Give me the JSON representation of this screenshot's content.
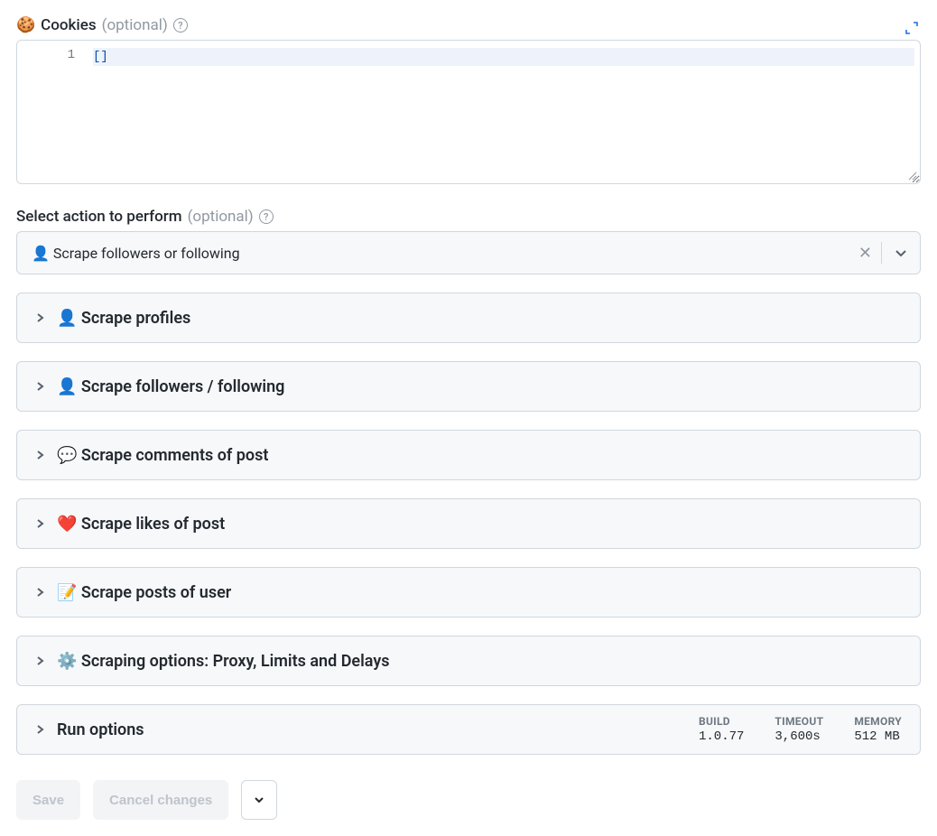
{
  "cookies": {
    "label_emoji": "🍪",
    "label_text": "Cookies",
    "optional": "(optional)",
    "line_number": "1",
    "content": "[]"
  },
  "action_select": {
    "label": "Select action to perform",
    "optional": "(optional)",
    "value": "👤 Scrape followers or following"
  },
  "accordions": [
    {
      "label": "👤 Scrape profiles"
    },
    {
      "label": "👤 Scrape followers / following"
    },
    {
      "label": "💬 Scrape comments of post"
    },
    {
      "label": "❤️ Scrape likes of post"
    },
    {
      "label": "📝 Scrape posts of user"
    },
    {
      "label": "⚙️ Scraping options: Proxy, Limits and Delays"
    }
  ],
  "run_options": {
    "label": "Run options",
    "build": {
      "label": "BUILD",
      "value": "1.0.77"
    },
    "timeout": {
      "label": "TIMEOUT",
      "value": "3,600s"
    },
    "memory": {
      "label": "MEMORY",
      "value": "512 MB"
    }
  },
  "footer": {
    "save": "Save",
    "cancel": "Cancel changes"
  }
}
